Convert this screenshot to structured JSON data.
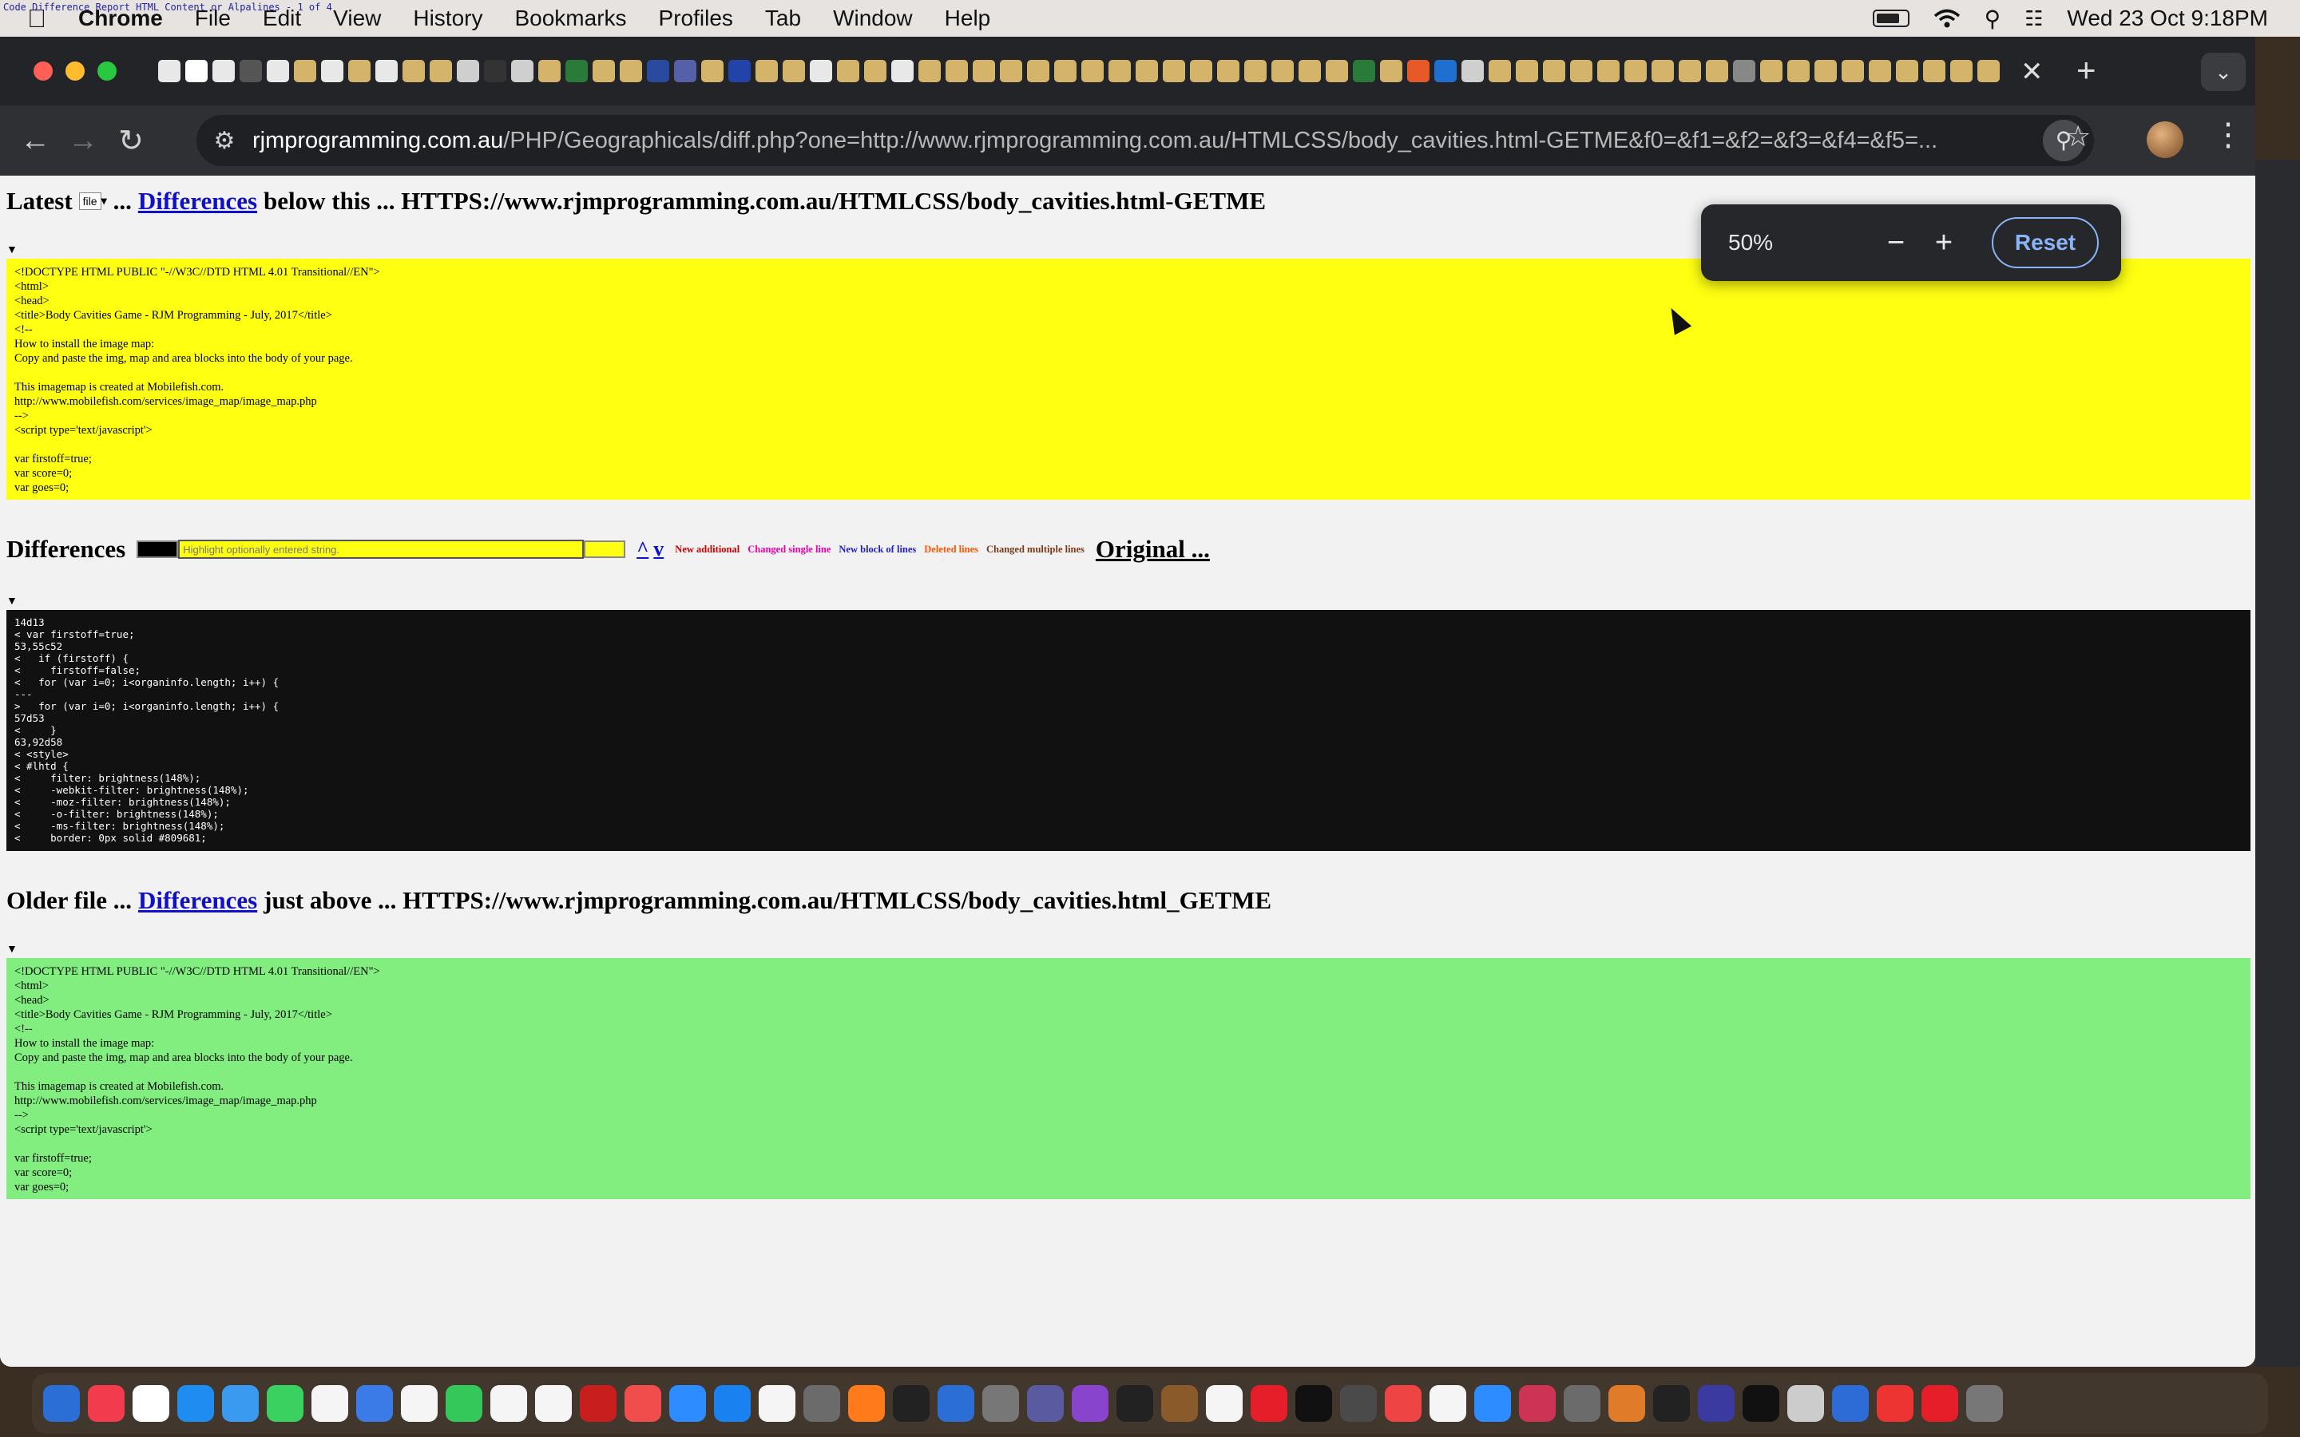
{
  "menubar": {
    "tiny_title": "Code Difference Report HTML Content or Alpalines - 1 of 4",
    "app": "Chrome",
    "items": [
      "File",
      "Edit",
      "View",
      "History",
      "Bookmarks",
      "Profiles",
      "Tab",
      "Window",
      "Help"
    ],
    "datetime": "Wed 23 Oct  9:18PM"
  },
  "browser": {
    "url_host": "rjmprogramming.com.au",
    "url_rest": "/PHP/Geographicals/diff.php?one=http://www.rjmprogramming.com.au/HTMLCSS/body_cavities.html-GETME&f0=&f1=&f2=&f3=&f4=&f5=...",
    "zoom": {
      "percent": "50%",
      "reset_label": "Reset"
    }
  },
  "page": {
    "latest": {
      "prefix": "Latest",
      "select_value": "file",
      "middle": "...",
      "link": "Differences",
      "suffix": "below this ... HTTPS://www.rjmprogramming.com.au/HTMLCSS/body_cavities.html-GETME",
      "code": "<!DOCTYPE HTML PUBLIC \"-//W3C//DTD HTML 4.01 Transitional//EN\">\n<html>\n<head>\n<title>Body Cavities Game - RJM Programming - July, 2017</title>\n<!--\nHow to install the image map:\nCopy and paste the img, map and area blocks into the body of your page.\n\nThis imagemap is created at Mobilefish.com.\nhttp://www.mobilefish.com/services/image_map/image_map.php\n-->\n<script type='text/javascript'>\n\nvar firstoff=true;\nvar score=0;\nvar goes=0;"
    },
    "differences": {
      "title": "Differences",
      "highlight_placeholder": "Highlight optionally entered string.",
      "up": "^",
      "down": "v",
      "legend": [
        {
          "label": "New additional",
          "color": "#cc0000"
        },
        {
          "label": "Changed single line",
          "color": "#ee00aa"
        },
        {
          "label": "New block of lines",
          "color": "#2222cc"
        },
        {
          "label": "Deleted lines",
          "color": "#ff5500"
        },
        {
          "label": "Changed multiple lines",
          "color": "#7a3a1a"
        }
      ],
      "original_link": "Original ...",
      "code": "14d13\n< var firstoff=true;\n53,55c52\n<   if (firstoff) {\n<     firstoff=false;\n<   for (var i=0; i<organinfo.length; i++) {\n---\n>   for (var i=0; i<organinfo.length; i++) {\n57d53\n<     }\n63,92d58\n< <style>\n< #lhtd {\n<     filter: brightness(148%);\n<     -webkit-filter: brightness(148%);\n<     -moz-filter: brightness(148%);\n<     -o-filter: brightness(148%);\n<     -ms-filter: brightness(148%);\n<     border: 0px solid #809681;"
    },
    "older": {
      "prefix": "Older file ...",
      "link": "Differences",
      "suffix": "just above ... HTTPS://www.rjmprogramming.com.au/HTMLCSS/body_cavities.html_GETME",
      "code": "<!DOCTYPE HTML PUBLIC \"-//W3C//DTD HTML 4.01 Transitional//EN\">\n<html>\n<head>\n<title>Body Cavities Game - RJM Programming - July, 2017</title>\n<!--\nHow to install the image map:\nCopy and paste the img, map and area blocks into the body of your page.\n\nThis imagemap is created at Mobilefish.com.\nhttp://www.mobilefish.com/services/image_map/image_map.php\n-->\n<script type='text/javascript'>\n\nvar firstoff=true;\nvar score=0;\nvar goes=0;"
    }
  },
  "dock_colors": [
    "#2b6fd6",
    "#f23c4d",
    "#ffffff",
    "#1e8cf0",
    "#3a9af0",
    "#3bd160",
    "#f5f5f5",
    "#3b7be8",
    "#f5f5f5",
    "#34c759",
    "#f5f5f5",
    "#f5f5f5",
    "#c81e1e",
    "#f14d4d",
    "#2d8cff",
    "#1a82f0",
    "#f5f5f5",
    "#6b6b6b",
    "#ff7a1a",
    "#222222",
    "#2b6fd6",
    "#777777",
    "#5a5aa0",
    "#8844cc",
    "#222222",
    "#8a5a2a",
    "#f5f5f5",
    "#e61e2a",
    "#111111",
    "#4a4a4a",
    "#e44",
    "#f5f5f5",
    "#2d8cff",
    "#cc3355",
    "#6b6b6b",
    "#e07b2a",
    "#222222",
    "#3a3aa0",
    "#111111",
    "#cccccc",
    "#2d6bd6",
    "#ee3333",
    "#e61e2a",
    "#777777"
  ]
}
